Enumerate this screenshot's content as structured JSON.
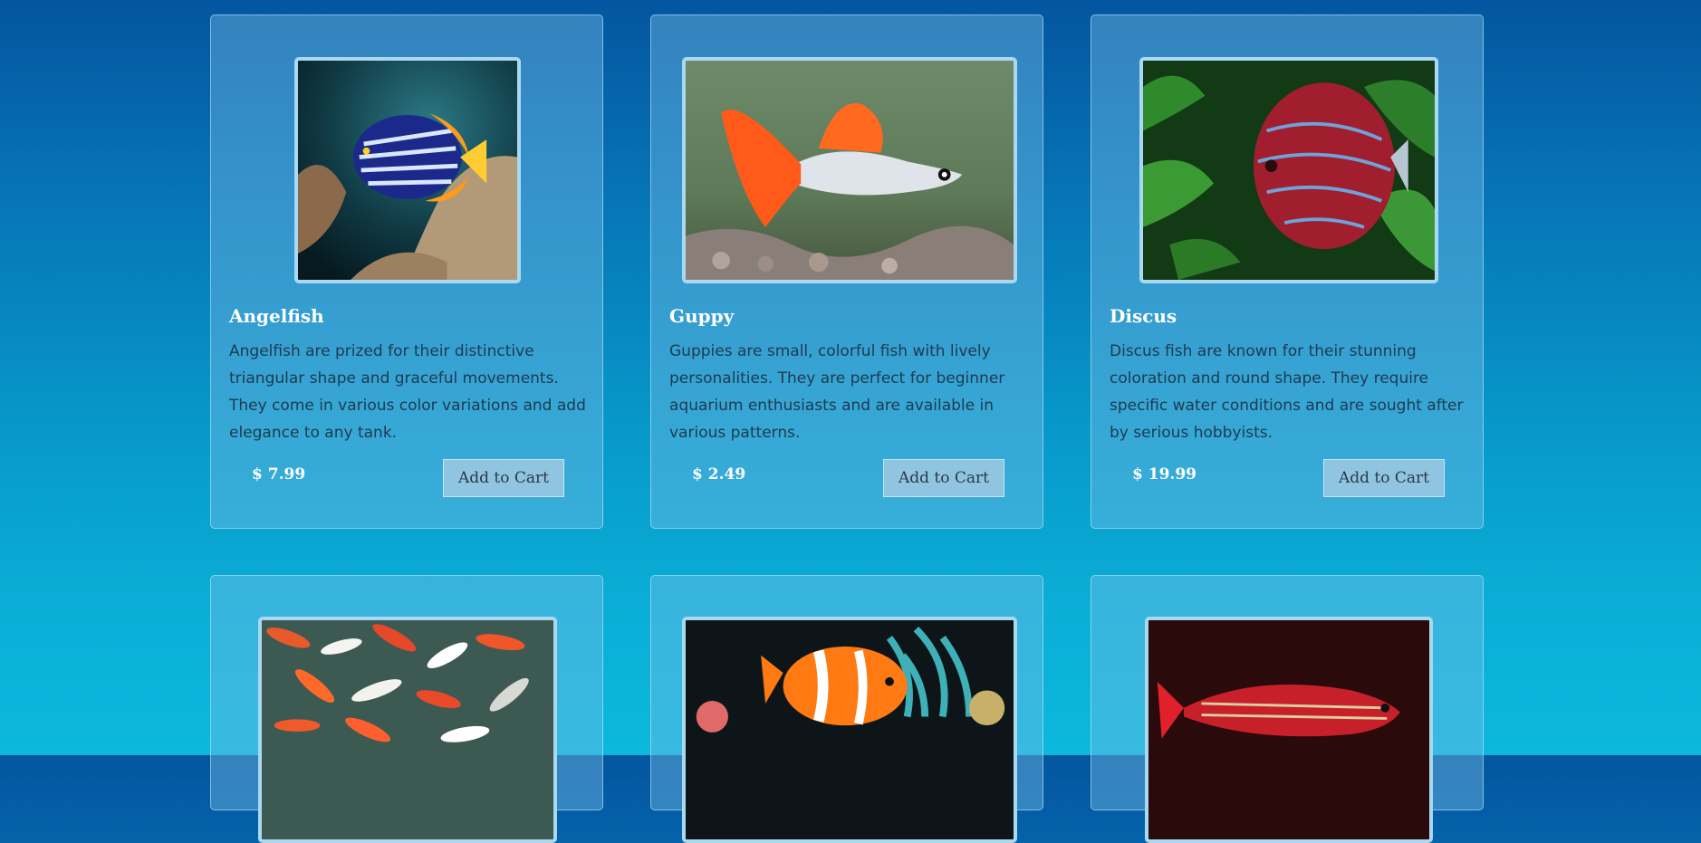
{
  "products": [
    {
      "name": "Angelfish",
      "description": "Angelfish are prized for their distinctive triangular shape and graceful movements. They come in various color variations and add elegance to any tank.",
      "price": "$ 7.99",
      "cart_label": "Add to Cart"
    },
    {
      "name": "Guppy",
      "description": "Guppies are small, colorful fish with lively personalities. They are perfect for beginner aquarium enthusiasts and are available in various patterns.",
      "price": "$ 2.49",
      "cart_label": "Add to Cart"
    },
    {
      "name": "Discus",
      "description": "Discus fish are known for their stunning coloration and round shape. They require specific water conditions and are sought after by serious hobbyists.",
      "price": "$ 19.99",
      "cart_label": "Add to Cart"
    },
    {
      "name": "",
      "description": "",
      "price": "",
      "cart_label": ""
    },
    {
      "name": "",
      "description": "",
      "price": "",
      "cart_label": ""
    },
    {
      "name": "",
      "description": "",
      "price": "",
      "cart_label": ""
    }
  ],
  "icons": {
    "card_images": [
      "angelfish-photo",
      "guppy-photo",
      "discus-photo",
      "koi-photo",
      "clownfish-photo",
      "rainbowfish-photo"
    ]
  }
}
